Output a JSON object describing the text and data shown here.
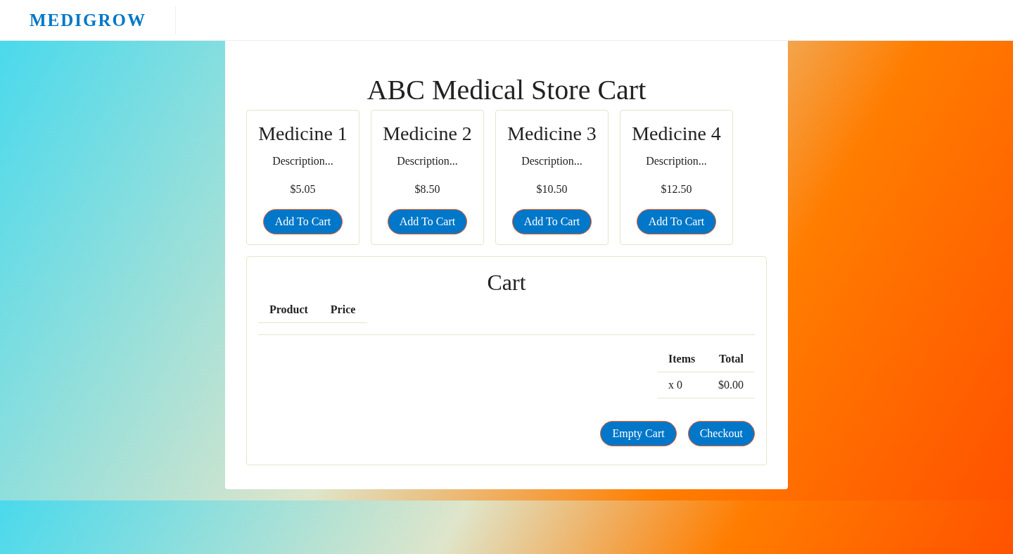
{
  "header": {
    "logo": "MEDIGROW"
  },
  "page": {
    "title": "ABC Medical Store Cart"
  },
  "products": [
    {
      "name": "Medicine 1",
      "description": "Description...",
      "price": "$5.05",
      "button": "Add To Cart"
    },
    {
      "name": "Medicine 2",
      "description": "Description...",
      "price": "$8.50",
      "button": "Add To Cart"
    },
    {
      "name": "Medicine 3",
      "description": "Description...",
      "price": "$10.50",
      "button": "Add To Cart"
    },
    {
      "name": "Medicine 4",
      "description": "Description...",
      "price": "$12.50",
      "button": "Add To Cart"
    }
  ],
  "cart": {
    "title": "Cart",
    "columns": [
      "Product",
      "Price"
    ],
    "summary": {
      "columns": [
        "Items",
        "Total"
      ],
      "values": [
        "x 0",
        "$0.00"
      ]
    },
    "buttons": [
      "Empty Cart",
      "Checkout"
    ]
  }
}
